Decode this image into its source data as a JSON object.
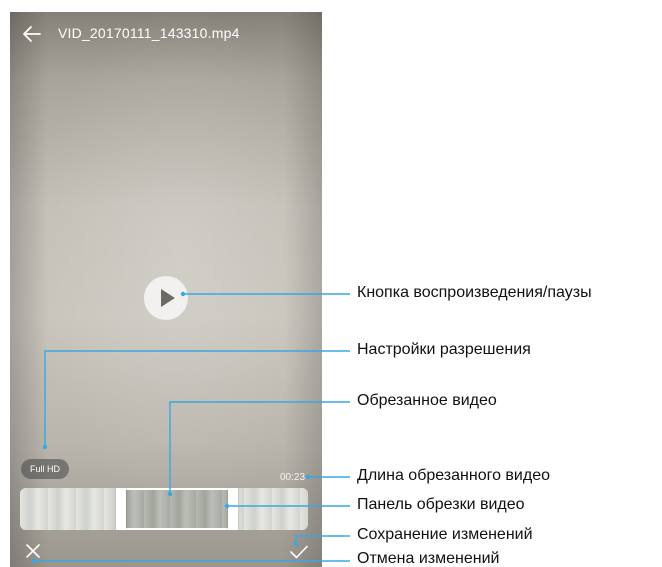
{
  "video": {
    "filename": "VID_20170111_143310.mp4",
    "resolution_badge": "Full HD",
    "trimmed_duration": "00:23"
  },
  "icons": {
    "back": "arrow-left-icon",
    "play": "play-icon",
    "cancel": "close-icon",
    "confirm": "checkmark-icon"
  },
  "callouts": {
    "play_pause": "Кнопка воспроизведения/паузы",
    "resolution": "Настройки разрешения",
    "trimmed_video": "Обрезанное видео",
    "trimmed_length": "Длина обрезанного видео",
    "trim_panel": "Панель обрезки видео",
    "save": "Сохранение изменений",
    "cancel": "Отмена изменений"
  },
  "colors": {
    "callout_line": "#3aa8e0",
    "label_text": "#111111"
  }
}
